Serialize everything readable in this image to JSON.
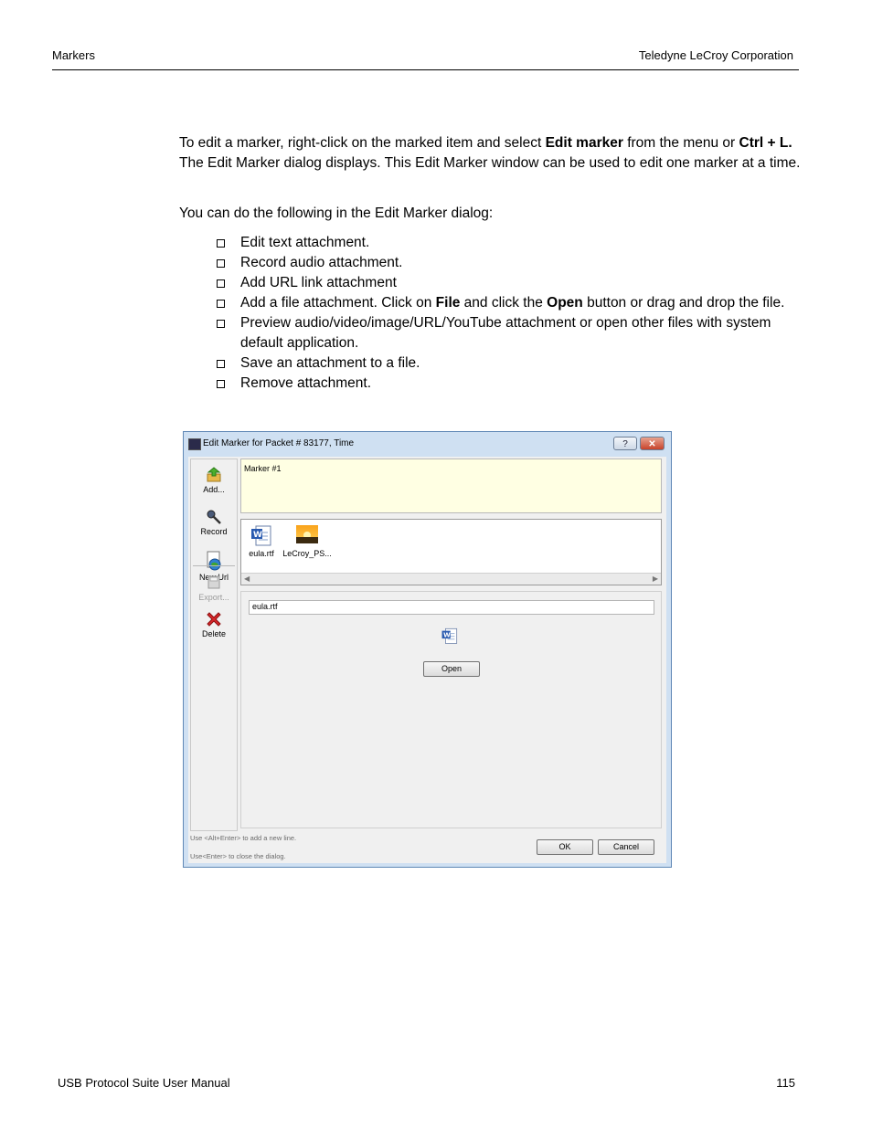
{
  "header": {
    "left": "Markers",
    "right": "Teledyne LeCroy Corporation"
  },
  "body": {
    "p1_parts": [
      "To edit a marker, right-click on the marked item and select ",
      "Edit marker",
      " from the menu or ",
      "Ctrl + L.",
      " The Edit Marker dialog displays. This Edit Marker window can be used to edit one marker at a time."
    ],
    "p2": "You can do the following in the Edit Marker dialog:",
    "bullets": [
      "Edit text attachment.",
      "Record audio attachment.",
      "Add URL link attachment",
      [
        "Add a file attachment. Click on ",
        "File",
        " and click the ",
        "Open",
        " button or drag and drop the file."
      ],
      "Preview audio/video/image/URL/YouTube attachment or open other files with system default application.",
      "Save an attachment to a file.",
      "Remove attachment."
    ]
  },
  "dialog": {
    "title": "Edit Marker for Packet # 83177, Time",
    "help_label": "?",
    "close_label": "✕",
    "tools": {
      "add": "Add...",
      "record": "Record",
      "newurl": "New Url",
      "export": "Export...",
      "delete": "Delete"
    },
    "marker_text": "Marker #1",
    "attachments": [
      "eula.rtf",
      "LeCroy_PS..."
    ],
    "filename": "eula.rtf",
    "open_label": "Open",
    "hint1": "Use <Alt+Enter> to add a new line.",
    "hint2": "Use<Enter> to close the dialog.",
    "ok_label": "OK",
    "cancel_label": "Cancel",
    "icons": {
      "title": "app-icon",
      "add": "add-arrow-icon",
      "record": "microphone-icon",
      "newurl": "url-globe-icon",
      "export": "save-disk-icon",
      "delete": "red-x-icon",
      "file": "word-document-icon",
      "image": "sunset-image-icon"
    }
  },
  "footer": {
    "left": "USB Protocol Suite User Manual",
    "right": "115"
  }
}
